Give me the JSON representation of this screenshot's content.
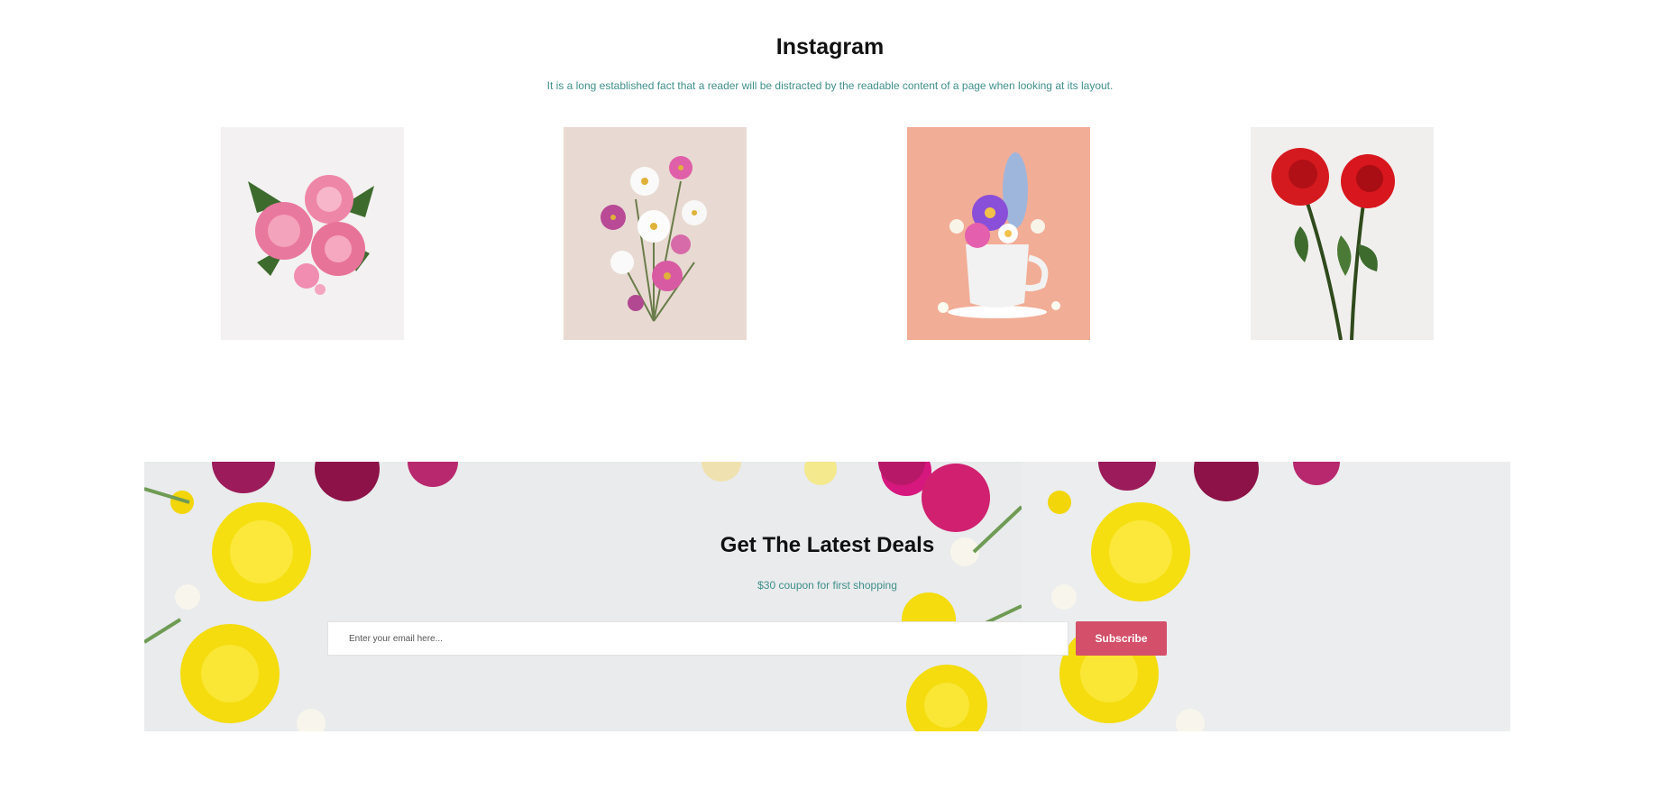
{
  "instagram": {
    "title": "Instagram",
    "subtitle": "It is a long established fact that a reader will be distracted by the readable content of a page when looking at its layout.",
    "images": [
      {
        "subject": "pink roses bouquet",
        "bg": "#f3f1f1"
      },
      {
        "subject": "pink and white cosmos bouquet",
        "bg": "#e8dad2"
      },
      {
        "subject": "flowers in white cup",
        "bg": "#f2ad96"
      },
      {
        "subject": "two red roses",
        "bg": "#f1efee"
      }
    ]
  },
  "deals": {
    "title": "Get The Latest Deals",
    "subtitle": "$30 coupon for first shopping",
    "email_placeholder": "Enter your email here...",
    "subscribe_label": "Subscribe",
    "accent_color": "#d4506a"
  }
}
